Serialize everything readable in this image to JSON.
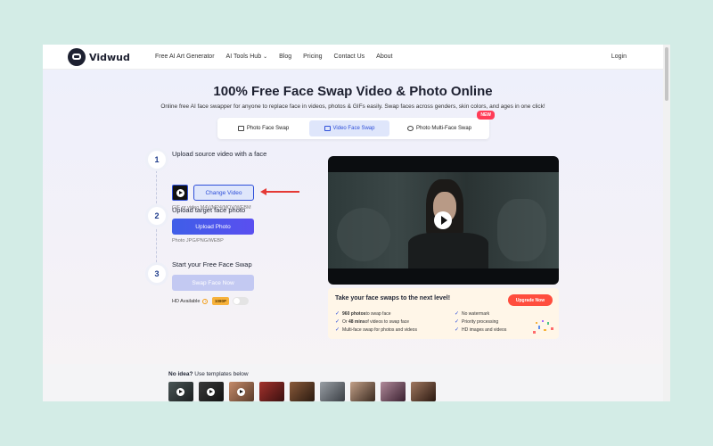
{
  "nav": {
    "brand": "Vidwud",
    "links": [
      "Free AI Art Generator",
      "AI Tools Hub",
      "Blog",
      "Pricing",
      "Contact Us",
      "About"
    ],
    "login": "Login"
  },
  "hero": {
    "title": "100% Free Face Swap Video & Photo Online",
    "subtitle": "Online free AI face swapper for anyone to replace face in videos, photos & GIFs easily. Swap faces across genders, skin colors, and ages in one click!"
  },
  "tabs": [
    {
      "label": "Photo Face Swap",
      "active": false
    },
    {
      "label": "Video Face Swap",
      "active": true
    },
    {
      "label": "Photo Multi-Face Swap",
      "active": false
    }
  ],
  "new_badge": "NEW",
  "steps": {
    "one": {
      "num": "1",
      "title": "Upload source video with a face",
      "button": "Change Video",
      "hint": "GIF or video M4V/MP4/MOV/WEBM"
    },
    "two": {
      "num": "2",
      "title": "Upload target face photo",
      "button": "Upload Photo",
      "hint": "Photo JPG/PNG/WEBP"
    },
    "three": {
      "num": "3",
      "title": "Start your Free Face Swap",
      "button": "Swap Face Now",
      "hd_label": "HD Available",
      "hd_badge": "1080P",
      "hd_enabled": false
    }
  },
  "promo": {
    "title": "Take your face swaps to the next level!",
    "button": "Upgrade Now",
    "features_left": [
      {
        "bold": "960 photos",
        "rest": " to swap face"
      },
      {
        "bold": "",
        "rest": "Or "
      },
      {
        "bold": "",
        "rest": "Multi-face swap for photos and videos"
      }
    ],
    "feature_mins_bold": "48 mins",
    "feature_mins_rest": " of videos to swap face",
    "features_right": [
      "No watermark",
      "Priority processing",
      "HD images and videos"
    ]
  },
  "templates": {
    "label_bold": "No idea?",
    "label_rest": " Use templates below"
  },
  "colors": {
    "accent": "#2e4fd9",
    "upgrade": "#ff4d3d",
    "new_badge": "#ff3c57",
    "background": "#d3ece6"
  }
}
